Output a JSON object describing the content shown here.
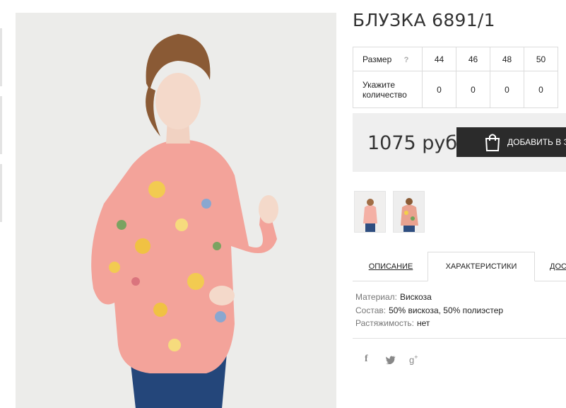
{
  "product": {
    "title": "БЛУЗКА 6891/1",
    "price": "1075 руб",
    "cart_label": "ДОБАВИТЬ В З"
  },
  "size_table": {
    "size_label": "Размер",
    "help": "?",
    "sizes": [
      "44",
      "46",
      "48",
      "50"
    ],
    "qty_label_line1": "Укажите",
    "qty_label_line2": "количество",
    "quantities": [
      "0",
      "0",
      "0",
      "0"
    ]
  },
  "tabs": [
    {
      "label": "ОПИСАНИЕ"
    },
    {
      "label": "ХАРАКТЕРИСТИКИ"
    },
    {
      "label": "ДОС"
    }
  ],
  "specs": [
    {
      "label": "Материал:",
      "value": "Вискоза"
    },
    {
      "label": "Состав:",
      "value": "50% вискоза, 50% полиэстер"
    },
    {
      "label": "Растяжимость:",
      "value": "нет"
    }
  ],
  "social": [
    {
      "icon": "facebook-icon",
      "glyph": "f"
    },
    {
      "icon": "twitter-icon",
      "glyph": "🐦"
    },
    {
      "icon": "google-plus-icon",
      "glyph": "g+"
    }
  ],
  "colors": {
    "button_bg": "#2b2b2b",
    "price_bg": "#efefef",
    "blouse": "#f3a39a"
  }
}
